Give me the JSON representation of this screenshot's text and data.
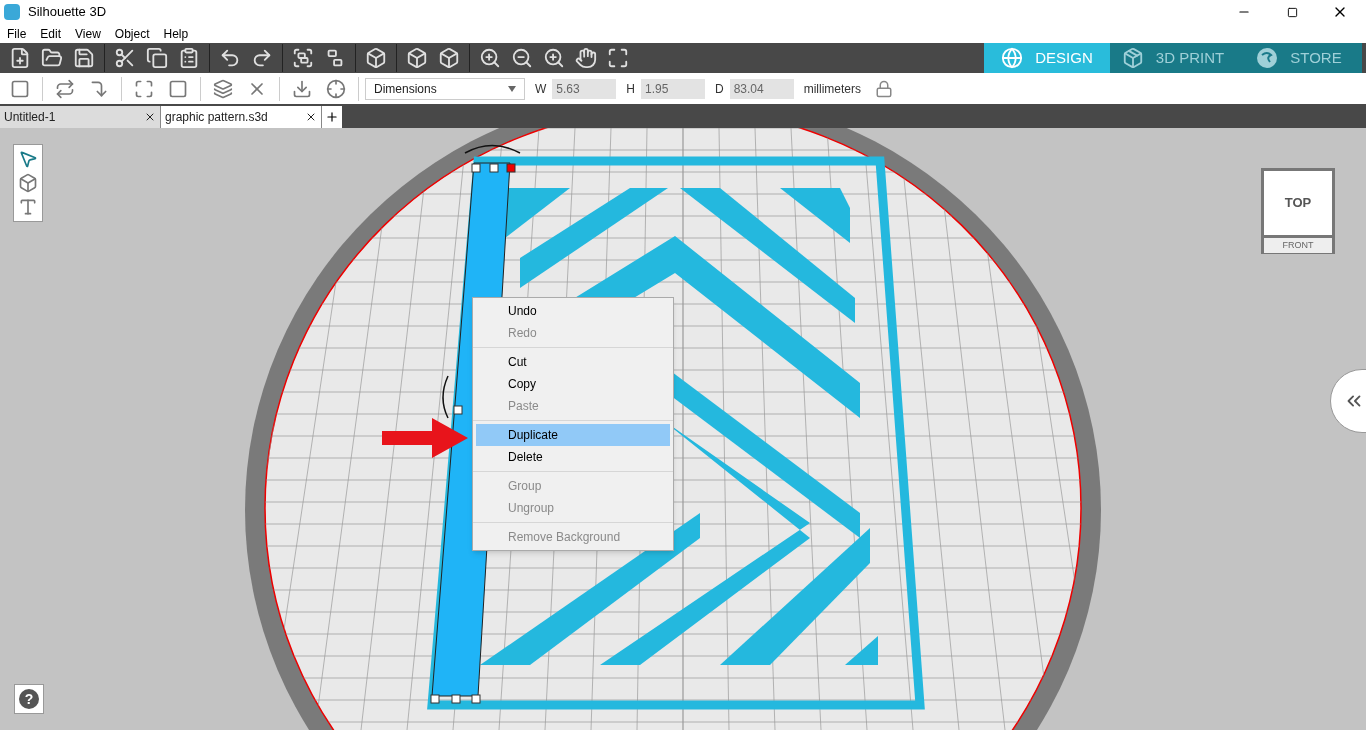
{
  "window": {
    "title": "Silhouette 3D"
  },
  "menu_bar": [
    "File",
    "Edit",
    "View",
    "Object",
    "Help"
  ],
  "mode_tabs": [
    {
      "label": "DESIGN",
      "selected": true,
      "kind": "globe"
    },
    {
      "label": "3D PRINT",
      "selected": false,
      "kind": "printer"
    },
    {
      "label": "STORE",
      "selected": false,
      "kind": "store"
    }
  ],
  "dimensions": {
    "mode": "Dimensions",
    "fields": [
      {
        "label": "W",
        "value": "5.63"
      },
      {
        "label": "H",
        "value": "1.95"
      },
      {
        "label": "D",
        "value": "83.04"
      }
    ],
    "unit": "millimeters"
  },
  "doc_tabs": [
    {
      "label": "Untitled-1",
      "selected": false
    },
    {
      "label": "graphic pattern.s3d",
      "selected": true
    }
  ],
  "view_cube": {
    "top": "TOP",
    "front": "FRONT"
  },
  "context_menu": {
    "groups": [
      [
        {
          "label": "Undo",
          "disabled": false,
          "selected": false
        },
        {
          "label": "Redo",
          "disabled": true,
          "selected": false
        }
      ],
      [
        {
          "label": "Cut",
          "disabled": false,
          "selected": false
        },
        {
          "label": "Copy",
          "disabled": false,
          "selected": false
        },
        {
          "label": "Paste",
          "disabled": true,
          "selected": false
        }
      ],
      [
        {
          "label": "Duplicate",
          "disabled": false,
          "selected": true
        },
        {
          "label": "Delete",
          "disabled": false,
          "selected": false
        }
      ],
      [
        {
          "label": "Group",
          "disabled": true,
          "selected": false
        },
        {
          "label": "Ungroup",
          "disabled": true,
          "selected": false
        }
      ],
      [
        {
          "label": "Remove Background",
          "disabled": true,
          "selected": false
        }
      ]
    ]
  },
  "help": "?"
}
